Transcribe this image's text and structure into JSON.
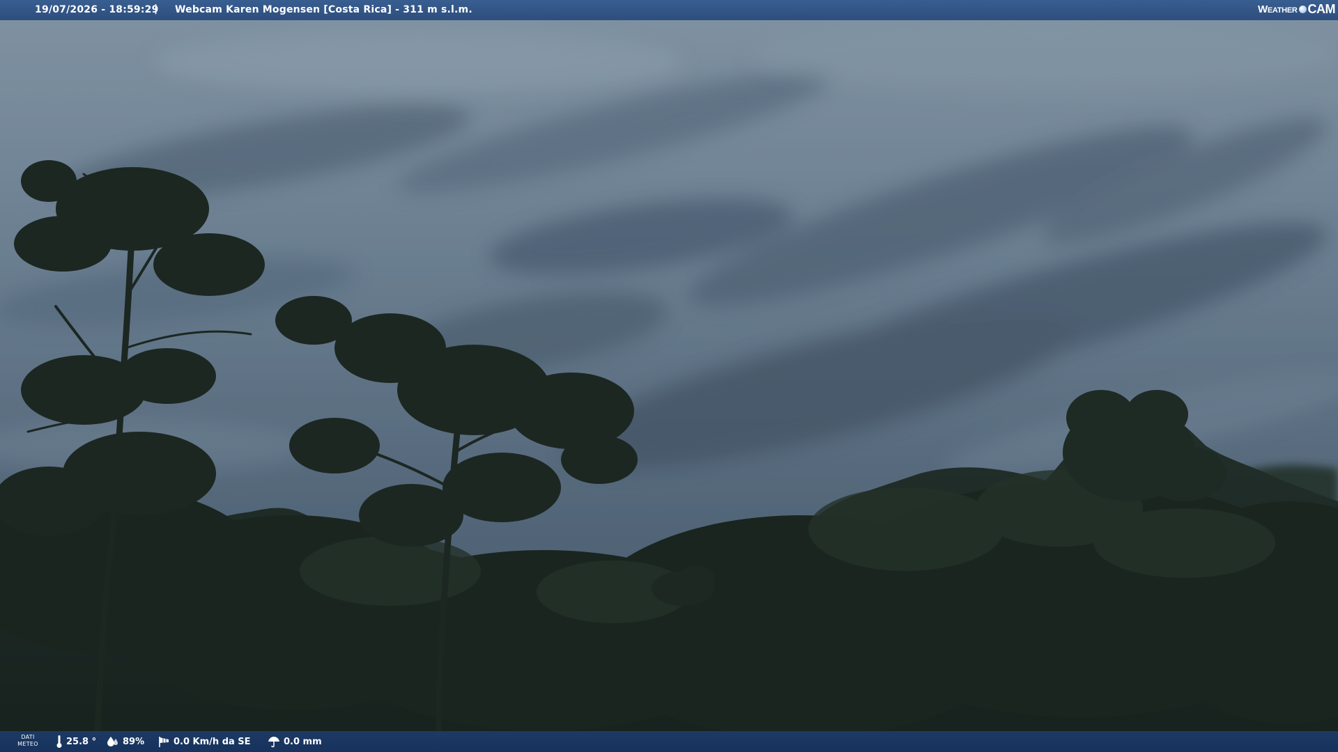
{
  "header": {
    "timestamp": "19/07/2026 - 18:59:29",
    "separator": "|",
    "title": "Webcam Karen Mogensen [Costa Rica] - 311 m s.l.m.",
    "brand_left": "Weather",
    "brand_right": "CAM"
  },
  "footer": {
    "label_line1": "DATI",
    "label_line2": "METEO",
    "temperature": "25.8 °",
    "humidity": "89%",
    "wind": "0.0 Km/h da SE",
    "rain": "0.0 mm"
  },
  "icons": {
    "temperature": "thermometer-icon",
    "humidity": "humidity-drop-icon",
    "wind": "windsock-icon",
    "rain": "umbrella-icon"
  },
  "colors": {
    "header_bg": "#32588e",
    "footer_bg": "#1e3e70",
    "sky": "#6f8598",
    "forest": "#1e2a22"
  }
}
